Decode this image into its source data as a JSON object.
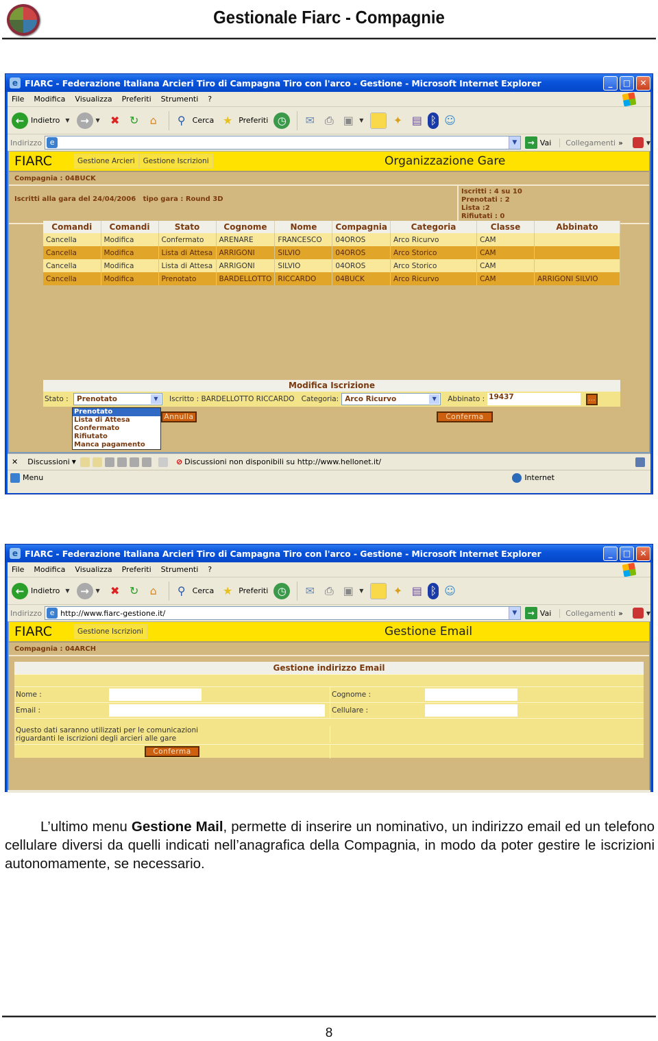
{
  "document": {
    "title": "Gestionale Fiarc - Compagnie",
    "page_number": "8",
    "paragraph": {
      "before_bold": "L’ultimo menu ",
      "bold": "Gestione Mail",
      "after_bold": ", permette di inserire un nominativo, un indirizzo email ed un telefono cellulare diversi da quelli indicati nell’anagrafica della Compagnia, in modo da poter gestire le iscrizioni autonomamente, se necessario."
    }
  },
  "browser": {
    "title": "FIARC - Federazione Italiana Arcieri Tiro di Campagna Tiro con l'arco - Gestione - Microsoft Internet Explorer",
    "menu": [
      "File",
      "Modifica",
      "Visualizza",
      "Preferiti",
      "Strumenti",
      "?"
    ],
    "toolbar": {
      "back": "Indietro",
      "search": "Cerca",
      "favorites": "Preferiti"
    },
    "address_label": "Indirizzo",
    "go_label": "Vai",
    "links_label": "Collegamenti",
    "links_chevron": "»",
    "window_buttons": {
      "minimize": "_",
      "maximize": "□",
      "close": "✕"
    }
  },
  "screenshot1": {
    "address_value": "",
    "brand": "FIARC",
    "nav": [
      "Gestione Arcieri",
      "Gestione Iscrizioni"
    ],
    "page_heading": "Organizzazione Gare",
    "compagnia": "Compagnia : 04BUCK",
    "gara_info": "Iscritti alla gara del 24/04/2006   tipo gara : Round 3D",
    "stats": [
      "Iscritti : 4 su 10",
      "Prenotati : 2",
      "Lista :2",
      "Rifiutati : 0"
    ],
    "table": {
      "headers": [
        "Comandi",
        "Comandi",
        "Stato",
        "Cognome",
        "Nome",
        "Compagnia",
        "Categoria",
        "Classe",
        "Abbinato"
      ],
      "rows": [
        [
          "Cancella",
          "Modifica",
          "Confermato",
          "ARENARE",
          "FRANCESCO",
          "04OROS",
          "Arco Ricurvo",
          "CAM",
          ""
        ],
        [
          "Cancella",
          "Modifica",
          "Lista di Attesa",
          "ARRIGONI",
          "SILVIO",
          "04OROS",
          "Arco Storico",
          "CAM",
          ""
        ],
        [
          "Cancella",
          "Modifica",
          "Lista di Attesa",
          "ARRIGONI",
          "SILVIO",
          "04OROS",
          "Arco Storico",
          "CAM",
          ""
        ],
        [
          "Cancella",
          "Modifica",
          "Prenotato",
          "BARDELLOTTO",
          "RICCARDO",
          "04BUCK",
          "Arco Ricurvo",
          "CAM",
          "ARRIGONI SILVIO"
        ]
      ]
    },
    "modify": {
      "title": "Modifica Iscrizione",
      "stato_label": "Stato :",
      "stato_value": "Prenotato",
      "stato_options": [
        "Prenotato",
        "Lista di Attesa",
        "Confermato",
        "Rifiutato",
        "Manca pagamento"
      ],
      "iscritto": "Iscritto : BARDELLOTTO RICCARDO",
      "categoria_label": "Categoria:",
      "categoria_value": "Arco Ricurvo",
      "abbinato_label": "Abbinato :",
      "abbinato_value": "19437",
      "lookup_button": "...",
      "cancel_button": "Annulla",
      "confirm_button": "Conferma"
    },
    "discussion_bar": {
      "label": "Discussioni",
      "message": "Discussioni non disponibili su http://www.hellonet.it/"
    },
    "status": {
      "left": "Menu",
      "zone": "Internet"
    }
  },
  "screenshot2": {
    "address_value": "http://www.fiarc-gestione.it/",
    "brand": "FIARC",
    "nav": [
      "Gestione Iscrizioni"
    ],
    "page_heading": "Gestione Email",
    "compagnia": "Compagnia : 04ARCH",
    "form": {
      "title": "Gestione indirizzo Email",
      "nome_label": "Nome :",
      "nome_value": "",
      "cognome_label": "Cognome :",
      "cognome_value": "",
      "email_label": "Email :",
      "email_value": "",
      "cellulare_label": "Cellulare :",
      "cellulare_value": "",
      "note_line1": "Questo dati saranno utilizzati per le comunicazioni",
      "note_line2": "riguardanti le iscrizioni degli arcieri alle gare",
      "confirm_button": "Conferma"
    }
  },
  "colors": {
    "yellow_bar": "#ffe200",
    "tan_bg": "#d2b77e",
    "row_light": "#f9e89a",
    "row_dark": "#e1a52a",
    "orange_button": "#cc6010",
    "xp_blue": "#0a52d8"
  }
}
